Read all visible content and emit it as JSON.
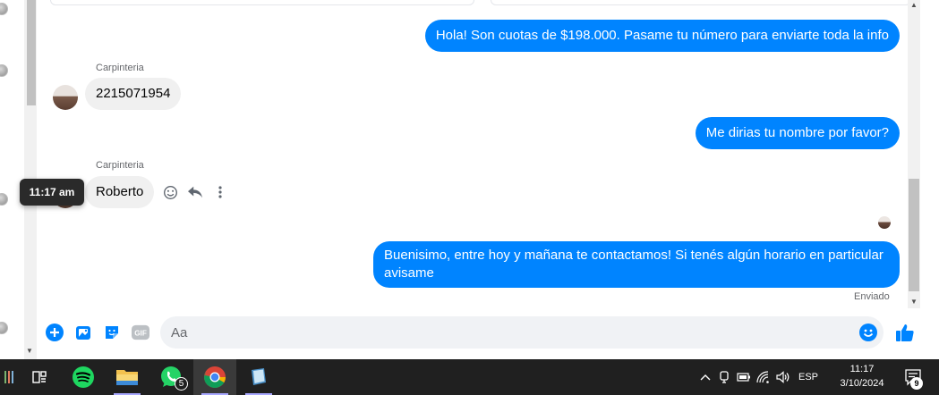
{
  "conversation": {
    "messages": [
      {
        "direction": "out",
        "text": "Hola! Son cuotas de $198.000. Pasame tu número para enviarte toda la info"
      },
      {
        "direction": "in",
        "sender": "Carpinteria",
        "text": "2215071954"
      },
      {
        "direction": "out",
        "text": "Me dirias tu nombre por favor?"
      },
      {
        "direction": "in",
        "sender": "Carpinteria",
        "text": "Roberto"
      },
      {
        "direction": "out",
        "text": "Buenisimo, entre hoy y mañana te contactamos! Si tenés algún horario en particular",
        "text_line2": "avisame"
      }
    ],
    "status": "Enviado",
    "hover_time": "11:17 am"
  },
  "composer": {
    "placeholder": "Aa",
    "icons": [
      "plus-circle-icon",
      "photo-icon",
      "sticker-icon",
      "gif-icon",
      "emoji-icon",
      "thumbs-up-icon"
    ],
    "gif_label": "GIF"
  },
  "taskbar": {
    "whatsapp_badge": "5",
    "language": "ESP",
    "time": "11:17",
    "date": "3/10/2024",
    "notifications": "9"
  },
  "colors": {
    "accent": "#0084ff",
    "incoming_bubble": "#f0f0f0",
    "taskbar": "#202020"
  }
}
